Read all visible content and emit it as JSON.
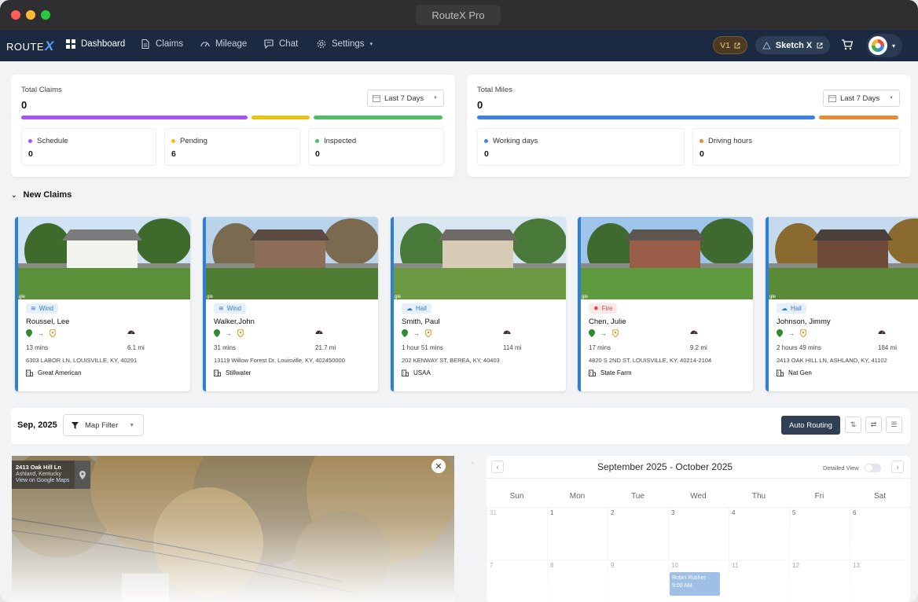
{
  "window": {
    "title": "RouteX Pro"
  },
  "nav": {
    "logo": {
      "text": "ROUTE",
      "x": "X"
    },
    "items": [
      {
        "label": "Dashboard",
        "icon": "grid-icon"
      },
      {
        "label": "Claims",
        "icon": "document-icon"
      },
      {
        "label": "Mileage",
        "icon": "speedometer-icon"
      },
      {
        "label": "Chat",
        "icon": "chat-icon"
      },
      {
        "label": "Settings",
        "icon": "gear-icon"
      }
    ],
    "v1_label": "V1",
    "sketch_label": "Sketch X"
  },
  "claims_stats": {
    "label": "Total Claims",
    "value": "0",
    "range": "Last 7 Days",
    "bar_colors": [
      "#a855f7",
      "#eac211",
      "#4cc061"
    ],
    "subs": [
      {
        "label": "Schedule",
        "value": "0",
        "color": "#a855f7"
      },
      {
        "label": "Pending",
        "value": "6",
        "color": "#eac211"
      },
      {
        "label": "Inspected",
        "value": "0",
        "color": "#4cc061"
      }
    ]
  },
  "miles_stats": {
    "label": "Total Miles",
    "value": "0",
    "range": "Last 7 Days",
    "bar_colors": [
      "#3b82e6",
      "#ea8a35"
    ],
    "subs": [
      {
        "label": "Working days",
        "value": "0",
        "color": "#3b82e6"
      },
      {
        "label": "Driving hours",
        "value": "0",
        "color": "#ea8a35"
      }
    ]
  },
  "new_claims": {
    "title": "New Claims",
    "cards": [
      {
        "peril": "Wind",
        "name": "Roussel, Lee",
        "mins": "13 mins",
        "miles": "6.1 mi",
        "address": "6303 LABOR LN, LOUISVILLE, KY, 40291",
        "insurer": "Great American"
      },
      {
        "peril": "Wind",
        "name": "Walker,John",
        "mins": "31 mins",
        "miles": "21.7 mi",
        "address": "13119 Willow Forest Dr, Louisville, KY, 402450000",
        "insurer": "Stillwater"
      },
      {
        "peril": "Hail",
        "name": "Smith, Paul",
        "mins": "1 hour 51 mins",
        "miles": "114 mi",
        "address": "202 KENWAY ST, BEREA, KY, 40403",
        "insurer": "USAA"
      },
      {
        "peril": "Fire",
        "name": "Chen, Julie",
        "mins": "17 mins",
        "miles": "9.2 mi",
        "address": "4820 S 2ND ST, LOUISVILLE, KY, 40214-2104",
        "insurer": "State Farm"
      },
      {
        "peril": "Hail",
        "name": "Johnson, Jimmy",
        "mins": "2 hours 49 mins",
        "miles": "184 mi",
        "address": "2413 OAK HILL LN, ASHLAND, KY, 41102",
        "insurer": "Nat Gen"
      }
    ],
    "gle": "gle"
  },
  "toolbar": {
    "month": "Sep, 2025",
    "map_filter": "Map Filter",
    "auto_routing": "Auto Routing"
  },
  "map": {
    "title": "2413 Oak Hill Ln",
    "subtitle": "Ashland, Kentucky",
    "link": "View on Google Maps"
  },
  "calendar": {
    "title": "September 2025 - October 2025",
    "detailed_view": "Detailed View",
    "days": [
      "Sun",
      "Mon",
      "Tue",
      "Wed",
      "Thu",
      "Fri",
      "Sat"
    ],
    "row1": [
      "31",
      "1",
      "2",
      "3",
      "4",
      "5",
      "6"
    ],
    "row2": [
      "7",
      "8",
      "9",
      "10",
      "11",
      "12",
      "13"
    ],
    "event": "Robin Rusher\n9:00 AM"
  }
}
